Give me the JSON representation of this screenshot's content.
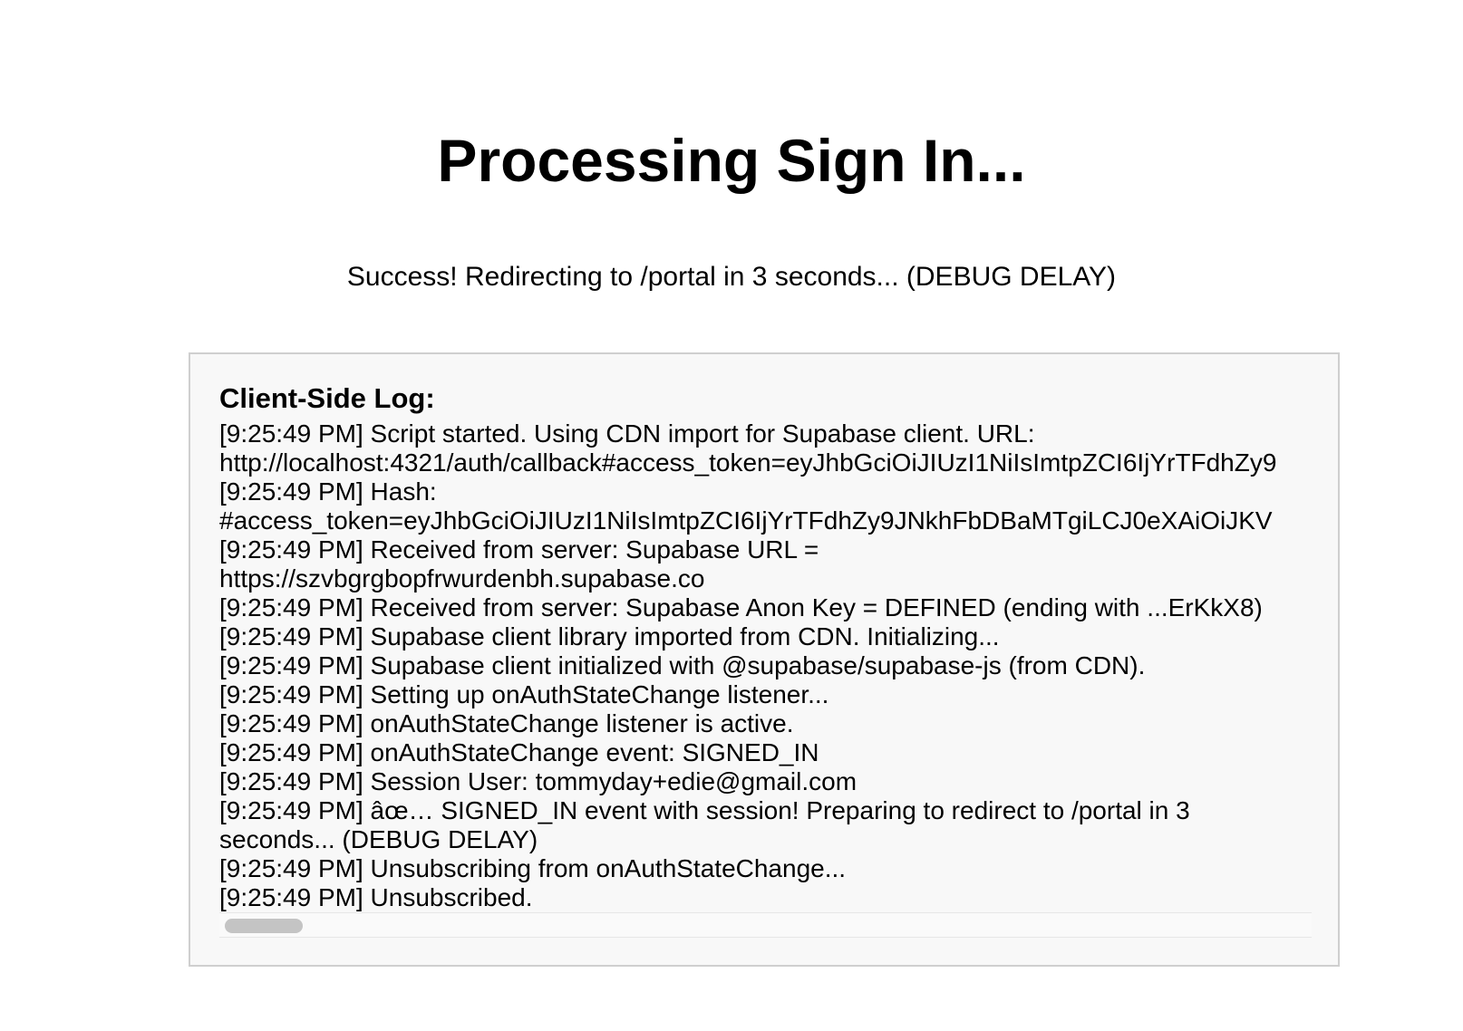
{
  "page": {
    "title": "Processing Sign In...",
    "status": "Success! Redirecting to /portal in 3 seconds... (DEBUG DELAY)"
  },
  "log": {
    "heading": "Client-Side Log:",
    "lines": [
      "[9:25:49 PM] Script started. Using CDN import for Supabase client. URL:",
      "http://localhost:4321/auth/callback#access_token=eyJhbGciOiJIUzI1NiIsImtpZCI6IjYrTFdhZy9",
      "[9:25:49 PM] Hash:",
      "#access_token=eyJhbGciOiJIUzI1NiIsImtpZCI6IjYrTFdhZy9JNkhFbDBaMTgiLCJ0eXAiOiJKV",
      "[9:25:49 PM] Received from server: Supabase URL =",
      "https://szvbgrgbopfrwurdenbh.supabase.co",
      "[9:25:49 PM] Received from server: Supabase Anon Key = DEFINED (ending with ...ErKkX8)",
      "[9:25:49 PM] Supabase client library imported from CDN. Initializing...",
      "[9:25:49 PM] Supabase client initialized with @supabase/supabase-js (from CDN).",
      "[9:25:49 PM] Setting up onAuthStateChange listener...",
      "[9:25:49 PM] onAuthStateChange listener is active.",
      "[9:25:49 PM] onAuthStateChange event: SIGNED_IN",
      "[9:25:49 PM] Session User: tommyday+edie@gmail.com",
      "[9:25:49 PM] âœ… SIGNED_IN event with session! Preparing to redirect to /portal in 3",
      "seconds... (DEBUG DELAY)",
      "[9:25:49 PM] Unsubscribing from onAuthStateChange...",
      "[9:25:49 PM] Unsubscribed."
    ]
  },
  "colors": {
    "background": "#ffffff",
    "log_background": "#f8f8f8",
    "log_border": "#cfcfcf",
    "text": "#000000",
    "scroll_thumb": "#c4c4c4"
  }
}
